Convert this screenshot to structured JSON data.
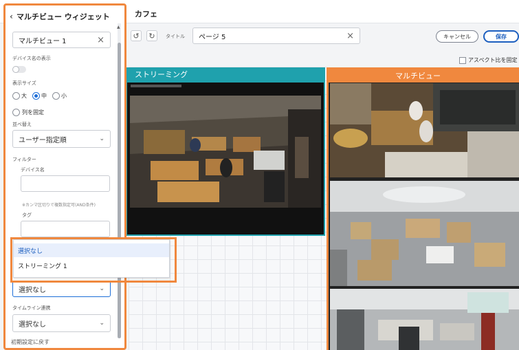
{
  "header": {
    "page_title": "カフェ"
  },
  "left_panel": {
    "back_icon": "chevron-left-icon",
    "title": "マルチビュー ウィジェット",
    "widget_name": {
      "value": "マルチビュー 1"
    },
    "device_name_display": {
      "label": "デバイス名の表示",
      "enabled": false
    },
    "display_size": {
      "label": "表示サイズ",
      "options": [
        "大",
        "中",
        "小"
      ],
      "selected": "中"
    },
    "fix_columns": {
      "label": "列を固定"
    },
    "sort": {
      "label": "並べ替え",
      "value": "ユーザー指定順"
    },
    "filter": {
      "label": "フィルター",
      "device_name_label": "デバイス名",
      "hint": "※カンマ区切りで複数指定可(AND条件)",
      "tag_label": "タグ"
    },
    "link_select": {
      "value": "選択なし"
    },
    "timeline_link": {
      "label": "タイムライン連携",
      "value": "選択なし"
    },
    "reset_label": "初期設定に戻す"
  },
  "dropdown": {
    "options": [
      "選択なし",
      "ストリーミング 1"
    ],
    "selected": "選択なし"
  },
  "toolbar": {
    "title_label": "タイトル",
    "title_value": "ページ 5",
    "cancel_label": "キャンセル",
    "save_label": "保存",
    "aspect_label": "アスペクト比を固定"
  },
  "widgets": {
    "streaming_label": "ストリーミング",
    "multiview_label": "マルチビュー"
  },
  "colors": {
    "accent_orange": "#f0883e",
    "streaming_teal": "#1fa1ad",
    "primary_blue": "#1d5fbf"
  }
}
